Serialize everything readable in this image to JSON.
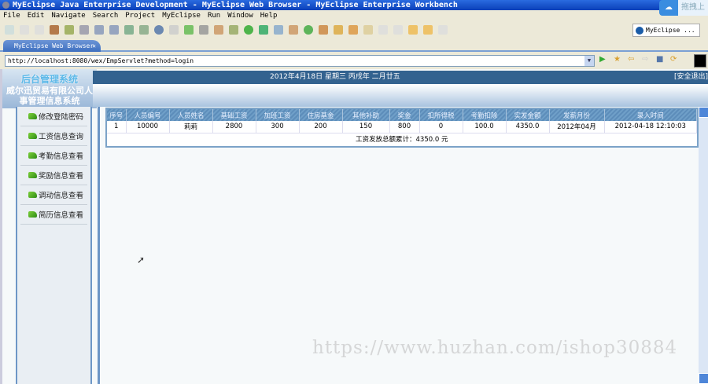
{
  "window": {
    "title": "MyEclipse Java Enterprise Development - MyEclipse Web Browser - MyEclipse Enterprise Workbench",
    "cloud_label": "拖拽上"
  },
  "menu": [
    "File",
    "Edit",
    "Navigate",
    "Search",
    "Project",
    "MyEclipse",
    "Run",
    "Window",
    "Help"
  ],
  "perspective": "MyEclipse ...",
  "tab": {
    "label": "MyEclipse Web Browser",
    "close": "✕"
  },
  "url": "http://localhost:8080/wex/EmpServlet?method=login",
  "header": {
    "logo_title": "后台管理系统",
    "company": "威尔迅贸易有限公司人事管理信息系统",
    "date": "2012年4月18日 星期三 丙戌年 二月廿五",
    "logout": "[安全退出]"
  },
  "sidebar": [
    "修改登陆密码",
    "工资信息查询",
    "考勤信息查看",
    "奖励信息查看",
    "调动信息查看",
    "简历信息查看"
  ],
  "table": {
    "headers": [
      "序号",
      "人员编号",
      "人员姓名",
      "基础工资",
      "加班工资",
      "住房基金",
      "其他补助",
      "奖金",
      "扣所得税",
      "考勤扣除",
      "实发金额",
      "发薪月份",
      "录入时间"
    ],
    "rows": [
      [
        "1",
        "10000",
        "莉莉",
        "2800",
        "300",
        "200",
        "150",
        "800",
        "0",
        "100.0",
        "4350.0",
        "2012年04月",
        "2012-04-18 12:10:03"
      ]
    ],
    "summary": "工资发放总额累计：4350.0 元"
  },
  "watermark": "https://www.huzhan.com/ishop30884",
  "colors": {
    "accent": "#33628f",
    "table_header": "#6f9fc8"
  }
}
